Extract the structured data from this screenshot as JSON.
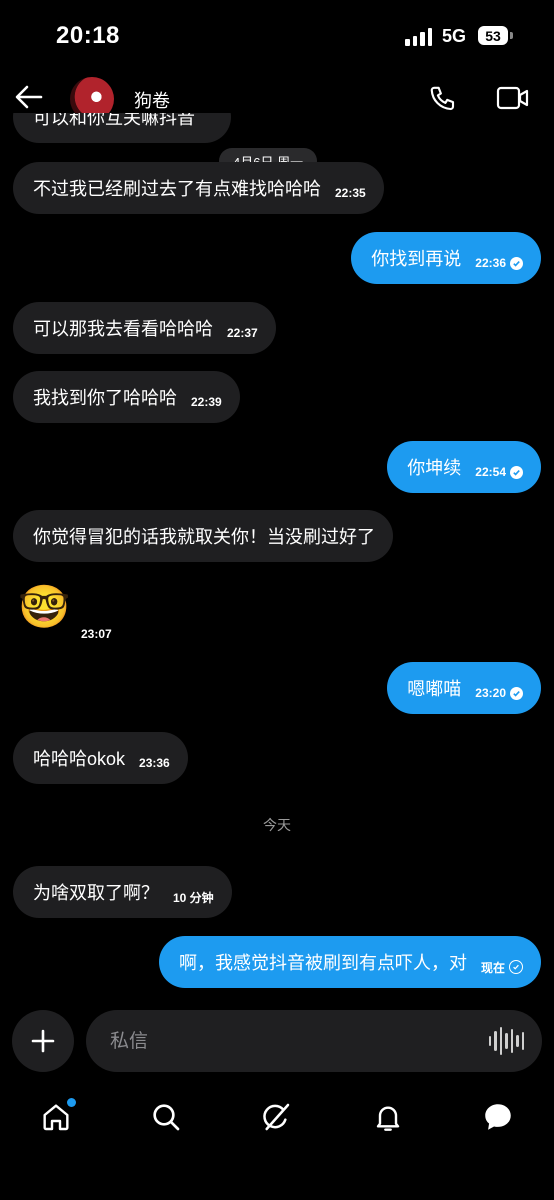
{
  "status_bar": {
    "time": "20:18",
    "network": "5G",
    "battery": "53"
  },
  "header": {
    "contact_name": "狗卷"
  },
  "conversation": {
    "partial_message": "可以和你互关嘛抖音",
    "date_label": "4月6日 周一",
    "messages": [
      {
        "text": "不过我已经刷过去了有点难找哈哈哈",
        "time": "22:35",
        "direction": "in"
      },
      {
        "text": "你找到再说",
        "time": "22:36",
        "direction": "out",
        "read": true
      },
      {
        "text": "可以那我去看看哈哈哈",
        "time": "22:37",
        "direction": "in"
      },
      {
        "text": "我找到你了哈哈哈",
        "time": "22:39",
        "direction": "in"
      },
      {
        "text": "你坤续",
        "time": "22:54",
        "direction": "out",
        "read": true
      },
      {
        "text": "你觉得冒犯的话我就取关你！当没刷过好了",
        "direction": "in"
      },
      {
        "text": "🤓",
        "time": "23:07",
        "direction": "in",
        "type": "emoji"
      },
      {
        "text": "嗯嘟喵",
        "time": "23:20",
        "direction": "out",
        "read": true
      },
      {
        "text": "哈哈哈okok",
        "time": "23:36",
        "direction": "in"
      },
      {
        "text": "为啥双取了啊？",
        "time": "10 分钟",
        "direction": "in"
      },
      {
        "text": "啊，我感觉抖音被刷到有点吓人，对",
        "time": "现在",
        "direction": "out",
        "read": false
      }
    ],
    "today_label": "今天"
  },
  "composer": {
    "placeholder": "私信"
  },
  "colors": {
    "accent": "#1d9bf0",
    "incoming_bubble": "#1f1f21",
    "background": "#000000",
    "notification_dot": "#1d9bf0"
  },
  "icons": [
    "back-arrow-icon",
    "phone-icon",
    "video-icon",
    "plus-icon",
    "voice-wave-icon",
    "home-icon",
    "search-icon",
    "grok-icon",
    "bell-icon",
    "messages-icon"
  ]
}
